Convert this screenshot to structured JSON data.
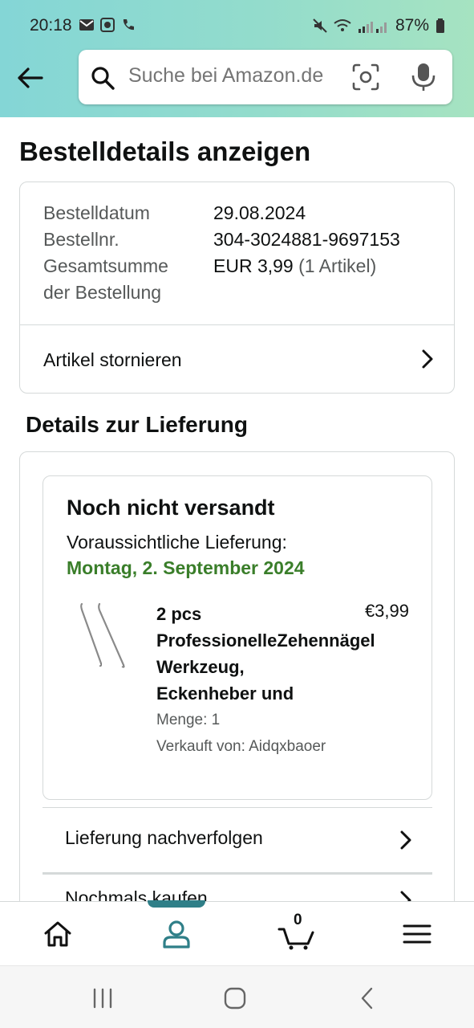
{
  "status_bar": {
    "time": "20:18",
    "battery": "87%",
    "left_icons": [
      "mail-icon",
      "app-icon",
      "call-icon"
    ],
    "right_icons": [
      "mute-icon",
      "wifi-call-icon",
      "signal-icon",
      "battery-icon"
    ]
  },
  "search": {
    "placeholder": "Suche bei Amazon.de"
  },
  "page": {
    "title": "Bestelldetails anzeigen"
  },
  "order": {
    "date_label": "Bestelldatum",
    "date_value": "29.08.2024",
    "number_label": "Bestellnr.",
    "number_value": "304-3024881-9697153",
    "total_label_line1": "Gesamtsumme",
    "total_label_line2": "der Bestellung",
    "total_value": "EUR 3,99",
    "total_items": "(1 Artikel)",
    "cancel_label": "Artikel stornieren"
  },
  "delivery": {
    "section_title": "Details zur Lieferung",
    "status": "Noch nicht versandt",
    "eta_label": "Voraussichtliche Lieferung:",
    "eta_date": "Montag, 2. September 2024",
    "product": {
      "title_line1": "2 pcs",
      "title_line2": "ProfessionelleZehennägel",
      "title_line3": "Werkzeug,",
      "title_line4": "Eckenheber und",
      "price": "€3,99",
      "quantity": "Menge: 1",
      "seller": "Verkauft von: Aidqxbaoer"
    },
    "track_label": "Lieferung nachverfolgen",
    "next_row_label": "Nochmals kaufen"
  },
  "bottom_nav": {
    "cart_count": "0",
    "active": "account",
    "active_color": "#2f7f88"
  },
  "colors": {
    "delivery_date": "#3a7e2a",
    "header_gradient_start": "#84d6d6",
    "header_gradient_end": "#a6e3c1"
  }
}
